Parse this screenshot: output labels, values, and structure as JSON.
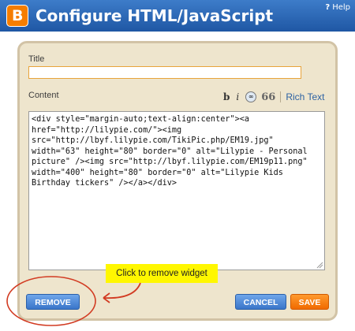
{
  "header": {
    "logo_letter": "B",
    "title": "Configure HTML/JavaScript",
    "help_icon": "?",
    "help_label": "Help"
  },
  "form": {
    "title_label": "Title",
    "title_value": "",
    "content_label": "Content",
    "toolbar": {
      "bold": "b",
      "italic": "i",
      "link_icon": "link-icon",
      "quote": "66",
      "rich_text": "Rich Text"
    },
    "content_value": "<div style=\"margin-auto;text-align:center\"><a\nhref=\"http://lilypie.com/\"><img\nsrc=\"http://lbyf.lilypie.com/TikiPic.php/EM19.jpg\"\nwidth=\"63\" height=\"80\" border=\"0\" alt=\"Lilypie - Personal\npicture\" /><img src=\"http://lbyf.lilypie.com/EM19p11.png\"\nwidth=\"400\" height=\"80\" border=\"0\" alt=\"Lilypie Kids\nBirthday tickers\" /></a></div>"
  },
  "buttons": {
    "remove": "REMOVE",
    "cancel": "CANCEL",
    "save": "SAVE"
  },
  "annotation": {
    "callout": "Click to remove widget"
  },
  "colors": {
    "header_bg": "#2a64b2",
    "panel_bg": "#eee5cd",
    "panel_border": "#d2c3a6",
    "primary_button": "#3975c9",
    "save_button": "#f06a00",
    "callout_bg": "#fff700",
    "annotation_red": "#d23b22"
  }
}
